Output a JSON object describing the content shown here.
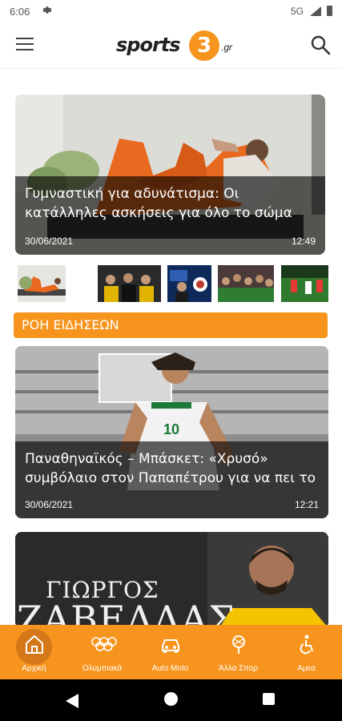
{
  "status_bar": {
    "time": "6:06",
    "network": "5G",
    "icons": [
      "settings-gear-icon",
      "signal-icon",
      "battery-icon"
    ]
  },
  "app_bar": {
    "logo_word": "sports",
    "logo_number": "3",
    "logo_tld": ".gr",
    "menu_icon": "hamburger-menu-icon",
    "search_icon": "search-icon"
  },
  "hero": {
    "title": "Γυμναστική για αδυνάτισμα: Οι κατάλληλες ασκήσεις για όλο το σώμα",
    "date": "30/06/2021",
    "time": "12:49"
  },
  "thumbnails": [
    "thumbnail-workout",
    "thumbnail-group-photo",
    "thumbnail-tv-studio",
    "thumbnail-crowd",
    "thumbnail-football-match"
  ],
  "section": {
    "title": "ΡΟΗ ΕΙΔΗΣΕΩΝ"
  },
  "news": [
    {
      "title": "Παναθηναϊκός – Μπάσκετ: «Χρυσό» συμβόλαιο στον Παπαπέτρου για να πει το",
      "date": "30/06/2021",
      "time": "12:21"
    },
    {
      "banner_line1": "ΓΙΩΡΓΟΣ",
      "banner_line2": "ΖΑΒΕΛΛΑΣ"
    }
  ],
  "bottom_nav": {
    "items": [
      {
        "label": "Αρχική",
        "icon": "home-icon",
        "active": true
      },
      {
        "label": "Ολυμπιακά",
        "icon": "olympic-rings-icon",
        "active": false
      },
      {
        "label": "Auto Moto",
        "icon": "car-icon",
        "active": false
      },
      {
        "label": "Άλλα Σπορ",
        "icon": "sports-ball-icon",
        "active": false
      },
      {
        "label": "Αμεα",
        "icon": "accessibility-icon",
        "active": false
      }
    ]
  },
  "colors": {
    "accent": "#f7941d",
    "accent_dark": "#d4781a",
    "overlay": "rgba(0,0,0,0.62)"
  }
}
